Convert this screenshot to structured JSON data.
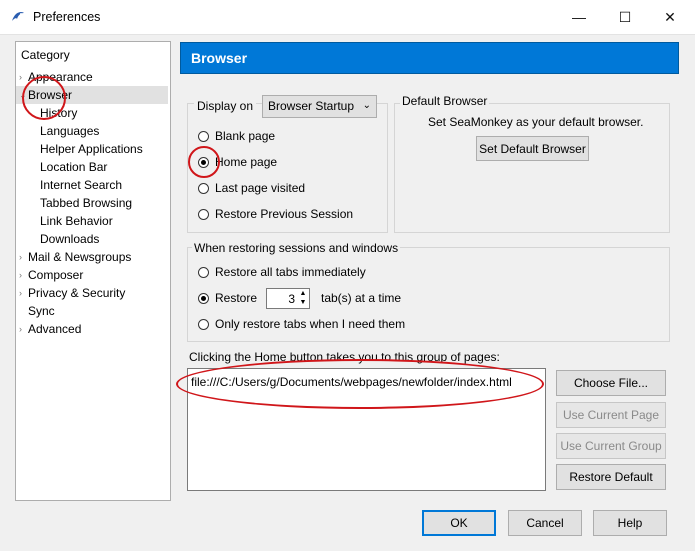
{
  "window": {
    "title": "Preferences",
    "controls": {
      "minimize": "—",
      "maximize": "☐",
      "close": "✕"
    }
  },
  "sidebar": {
    "category_label": "Category",
    "items": [
      {
        "label": "Appearance",
        "level": 0,
        "expander": "›"
      },
      {
        "label": "Browser",
        "level": 0,
        "expander": "⌄",
        "selected": true
      },
      {
        "label": "History",
        "level": 1
      },
      {
        "label": "Languages",
        "level": 1
      },
      {
        "label": "Helper Applications",
        "level": 1
      },
      {
        "label": "Location Bar",
        "level": 1
      },
      {
        "label": "Internet Search",
        "level": 1
      },
      {
        "label": "Tabbed Browsing",
        "level": 1
      },
      {
        "label": "Link Behavior",
        "level": 1
      },
      {
        "label": "Downloads",
        "level": 1
      },
      {
        "label": "Mail & Newsgroups",
        "level": 0,
        "expander": "›"
      },
      {
        "label": "Composer",
        "level": 0,
        "expander": "›"
      },
      {
        "label": "Privacy & Security",
        "level": 0,
        "expander": "›"
      },
      {
        "label": "Sync",
        "level": 0
      },
      {
        "label": "Advanced",
        "level": 0,
        "expander": "›"
      }
    ]
  },
  "header": {
    "title": "Browser"
  },
  "display_on": {
    "label": "Display on",
    "selected": "Browser Startup",
    "options": [
      {
        "label": "Blank page",
        "checked": false
      },
      {
        "label": "Home page",
        "checked": true
      },
      {
        "label": "Last page visited",
        "checked": false
      },
      {
        "label": "Restore Previous Session",
        "checked": false
      }
    ]
  },
  "default_browser": {
    "legend": "Default Browser",
    "text": "Set SeaMonkey as your default browser.",
    "button": "Set Default Browser"
  },
  "restore_sessions": {
    "legend": "When restoring sessions and windows",
    "option_all": "Restore all tabs immediately",
    "option_restore": "Restore",
    "tab_count": "3",
    "tab_suffix": "tab(s) at a time",
    "option_only": "Only restore tabs when I need them",
    "checked": "restore"
  },
  "home": {
    "label": "Clicking the Home button takes you to this group of pages:",
    "value": "file:///C:/Users/g/Documents/webpages/newfolder/index.html",
    "buttons": {
      "choose_file": "Choose File...",
      "use_current_page": "Use Current Page",
      "use_current_group": "Use Current Group",
      "restore_default": "Restore Default"
    }
  },
  "footer": {
    "ok": "OK",
    "cancel": "Cancel",
    "help": "Help"
  },
  "colors": {
    "accent": "#0078d7",
    "annotation": "#d0161a"
  }
}
